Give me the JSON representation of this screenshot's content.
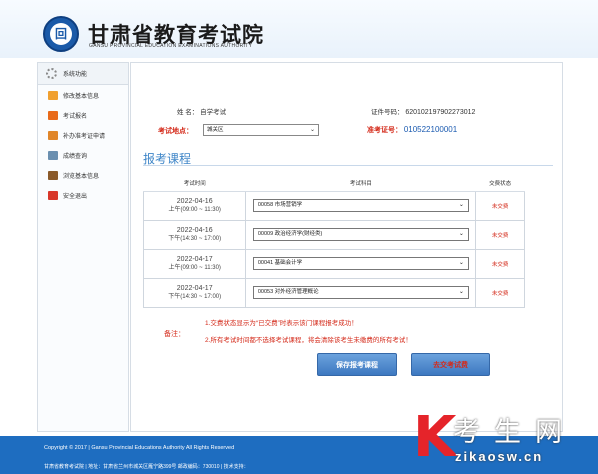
{
  "header": {
    "title": "甘肃省教育考试院",
    "subtitle": "GANSU PROVINCIAL EDUCATION EXAMINATIONS AUTHORITY",
    "logo_char": "回"
  },
  "sidebar": {
    "heading": "系统功能",
    "items": [
      {
        "label": "修改基本信息",
        "icon": "edit-icon"
      },
      {
        "label": "考试报名",
        "icon": "register-icon"
      },
      {
        "label": "补办准考证申请",
        "icon": "card-icon"
      },
      {
        "label": "成绩查询",
        "icon": "score-icon"
      },
      {
        "label": "浏览基本信息",
        "icon": "info-icon"
      },
      {
        "label": "安全退出",
        "icon": "exit-icon"
      }
    ]
  },
  "profile": {
    "name_label": "姓  名：",
    "name_value": "自学考试",
    "id_label": "证件号码：",
    "id_value": "620102197902273012",
    "location_label": "考试地点：",
    "location_value": "城关区",
    "ticket_label": "准考证号：",
    "ticket_value": "010522100001"
  },
  "section_title": "报考课程",
  "table": {
    "headers": [
      "考试时间",
      "考试科目",
      "交费状态"
    ],
    "rows": [
      {
        "date": "2022-04-16",
        "time": "上午(09:00 ~ 11:30)",
        "subject": "00058 市场营销学",
        "status": "未交费"
      },
      {
        "date": "2022-04-16",
        "time": "下午(14:30 ~ 17:00)",
        "subject": "00009 政治经济学(财经类)",
        "status": "未交费"
      },
      {
        "date": "2022-04-17",
        "time": "上午(09:00 ~ 11:30)",
        "subject": "00041 基础会计学",
        "status": "未交费"
      },
      {
        "date": "2022-04-17",
        "time": "下午(14:30 ~ 17:00)",
        "subject": "00053 对外经济管理概论",
        "status": "未交费"
      }
    ]
  },
  "notes": {
    "label": "备注：",
    "line1": "1.交费状态显示为“已交费”时表示该门课程报考成功！",
    "line2": "2.所有考试时间都不选择考试课程，将会清除该考生未缴费的所有考试！"
  },
  "buttons": {
    "save": "保存报考课程",
    "pay": "去交考试费"
  },
  "footer": {
    "copyright": "Copyright © 2017 | Gansu Provincial Educations Authority All Rights Reserved",
    "info": "甘肃省教育考试院 | 地址：甘肃省兰州市城关区雁宁路399号 邮政编码：730010 | 技术支持："
  },
  "watermark": {
    "letter": "K",
    "text": "考生网",
    "url": "zikaosw.cn"
  },
  "colors": {
    "accent_blue": "#1e6dc0",
    "alert_red": "#d42a1a",
    "title_blue": "#3f86c8"
  }
}
